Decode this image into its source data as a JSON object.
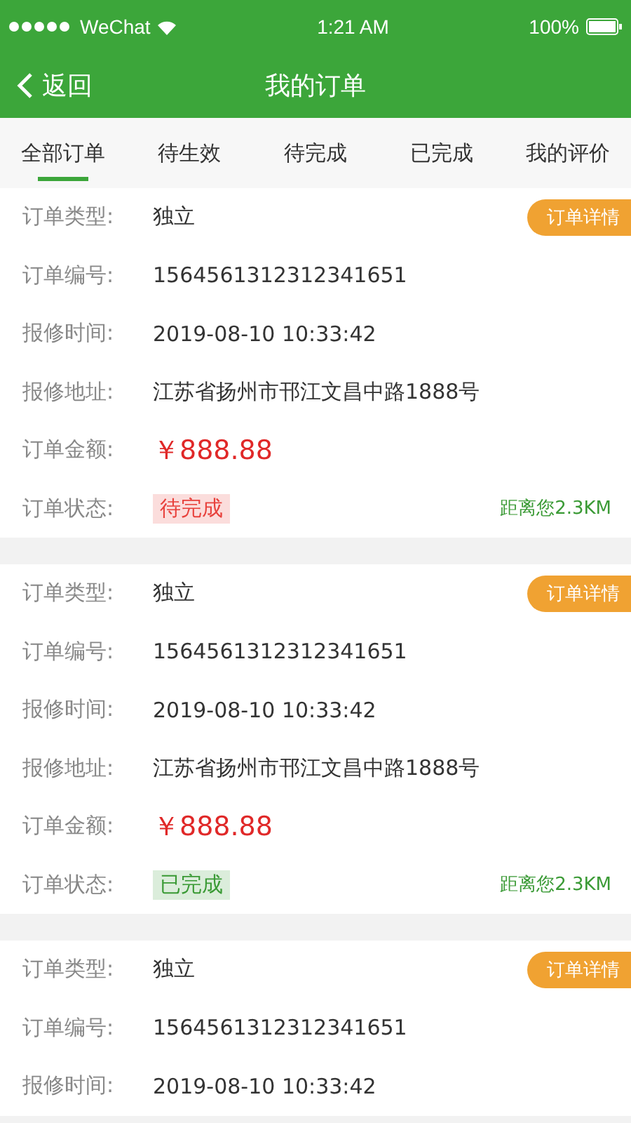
{
  "status_bar": {
    "carrier": "WeChat",
    "time": "1:21 AM",
    "battery": "100%"
  },
  "nav": {
    "back": "返回",
    "title": "我的订单"
  },
  "tabs": [
    {
      "label": "全部订单",
      "selected": true
    },
    {
      "label": "待生效",
      "selected": false
    },
    {
      "label": "待完成",
      "selected": false
    },
    {
      "label": "已完成",
      "selected": false
    },
    {
      "label": "我的评价",
      "selected": false
    }
  ],
  "orders": [
    {
      "detail_button": "订单详情",
      "distance": "距离您2.3KM",
      "rows": [
        {
          "label": "订单类型:",
          "value": "独立",
          "kind": "text"
        },
        {
          "label": "订单编号:",
          "value": "1564561312312341651",
          "kind": "text"
        },
        {
          "label": "报修时间:",
          "value": "2019-08-10 10:33:42",
          "kind": "text"
        },
        {
          "label": "报修地址:",
          "value": "江苏省扬州市邗江文昌中路1888号",
          "kind": "text"
        },
        {
          "label": "订单金额:",
          "value": "￥888.88",
          "kind": "amount"
        },
        {
          "label": "订单状态:",
          "value": "待完成",
          "kind": "status",
          "color": "#e8413c"
        }
      ]
    },
    {
      "detail_button": "订单详情",
      "distance": "距离您2.3KM",
      "rows": [
        {
          "label": "订单类型:",
          "value": "独立",
          "kind": "text"
        },
        {
          "label": "订单编号:",
          "value": "1564561312312341651",
          "kind": "text"
        },
        {
          "label": "报修时间:",
          "value": "2019-08-10 10:33:42",
          "kind": "text"
        },
        {
          "label": "报修地址:",
          "value": "江苏省扬州市邗江文昌中路1888号",
          "kind": "text"
        },
        {
          "label": "订单金额:",
          "value": "￥888.88",
          "kind": "amount"
        },
        {
          "label": "订单状态:",
          "value": "已完成",
          "kind": "status",
          "color": "#3a9a35"
        }
      ]
    },
    {
      "detail_button": "订单详情",
      "rows": [
        {
          "label": "订单类型:",
          "value": "独立",
          "kind": "text"
        },
        {
          "label": "订单编号:",
          "value": "1564561312312341651",
          "kind": "text"
        },
        {
          "label": "报修时间:",
          "value": "2019-08-10 10:33:42",
          "kind": "text"
        }
      ]
    }
  ]
}
